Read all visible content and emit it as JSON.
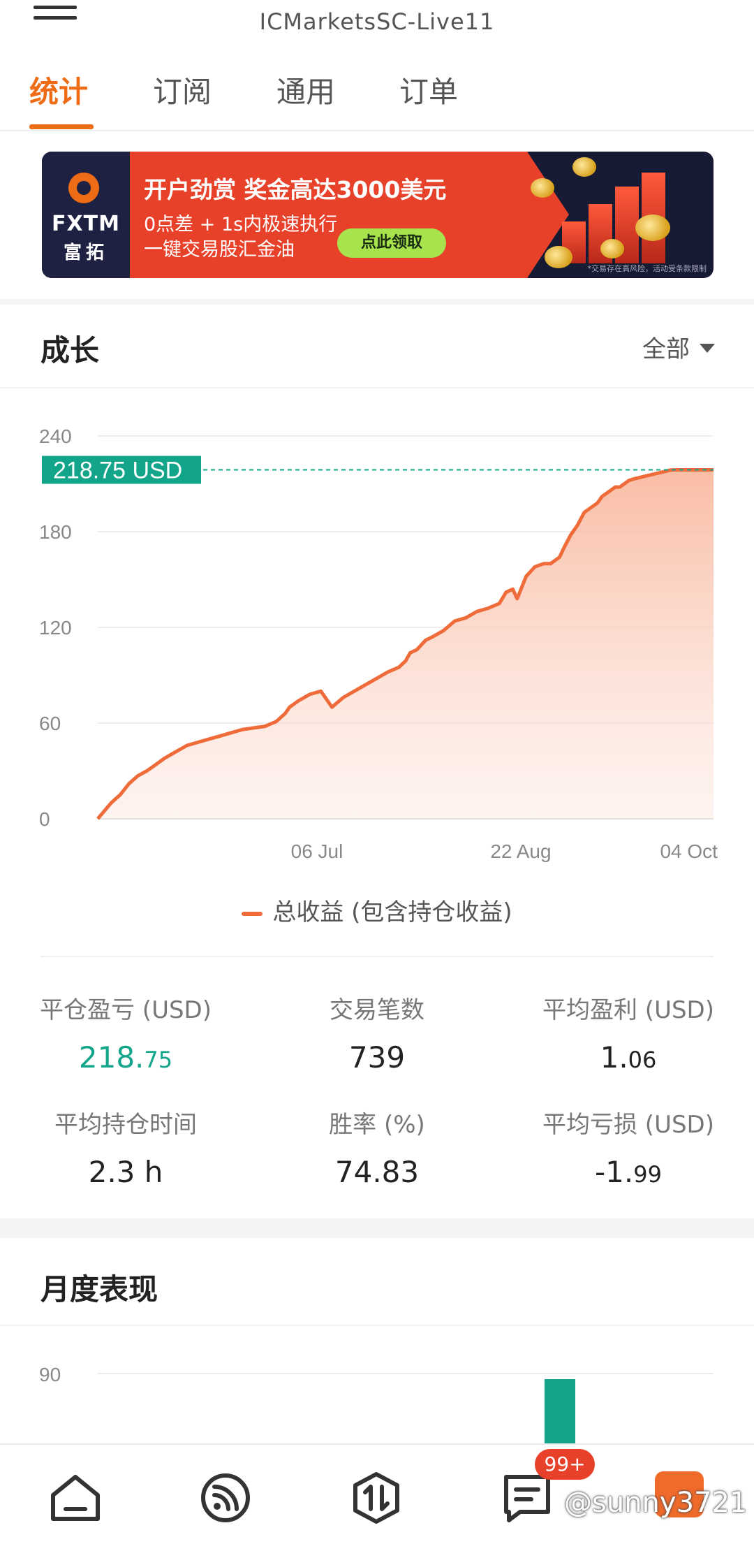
{
  "header": {
    "title": "ICMarketsSC-Live11"
  },
  "tabs": [
    {
      "label": "统计",
      "active": true
    },
    {
      "label": "订阅",
      "active": false
    },
    {
      "label": "通用",
      "active": false
    },
    {
      "label": "订单",
      "active": false
    }
  ],
  "banner": {
    "logo_text": "FXTM",
    "logo_cn": "富拓",
    "headline": "开户劲赏 奖金高达3000美元",
    "line1": "0点差 + 1s内极速执行",
    "line2": "一键交易股汇金油",
    "cta": "点此领取",
    "disclaimer": "*交易存在高风险，活动受条款限制"
  },
  "growth": {
    "title": "成长",
    "filter": "全部",
    "current_label": "218.75 USD",
    "legend": "总收益 (包含持仓收益)"
  },
  "chart_data": {
    "type": "area",
    "series": [
      {
        "name": "总收益 (包含持仓收益)",
        "x": [
          0,
          3,
          6,
          10,
          14,
          18,
          22,
          26,
          30,
          35,
          40,
          45,
          50,
          55,
          60,
          65,
          70,
          75,
          80,
          84,
          86,
          88,
          90,
          95,
          100,
          105,
          110,
          115,
          120,
          125,
          130,
          135,
          138,
          140,
          143,
          147,
          150,
          155,
          160,
          165,
          170,
          175,
          180,
          183,
          186,
          188,
          192,
          196,
          200,
          203,
          205,
          207,
          209,
          212,
          215,
          218,
          220,
          222,
          224,
          226,
          228,
          230,
          232,
          234,
          236,
          238,
          240,
          243,
          246,
          249,
          252,
          255,
          256,
          258,
          260,
          262,
          264,
          266,
          268,
          270,
          272,
          274,
          276
        ],
        "y": [
          0,
          5,
          10,
          15,
          22,
          27,
          30,
          34,
          38,
          42,
          46,
          48,
          50,
          52,
          54,
          56,
          57,
          58,
          61,
          66,
          70,
          72,
          74,
          78,
          80,
          70,
          76,
          80,
          84,
          88,
          92,
          95,
          99,
          104,
          106,
          112,
          114,
          118,
          124,
          126,
          130,
          132,
          135,
          142,
          144,
          138,
          152,
          158,
          160,
          160,
          162,
          164,
          170,
          178,
          184,
          192,
          194,
          196,
          198,
          202,
          204,
          206,
          208,
          208,
          210,
          212,
          213,
          214,
          215,
          216,
          217,
          218,
          218.5,
          218.7,
          218.75,
          218.75,
          218.75,
          218.75,
          218.75,
          218.75,
          218.75,
          218.75,
          218.75
        ]
      }
    ],
    "x_ticks": [
      "06 Jul",
      "22 Aug",
      "04 Oct"
    ],
    "y_ticks": [
      0,
      60,
      120,
      180,
      240
    ],
    "ylim": [
      0,
      240
    ],
    "grid": true,
    "colors": {
      "line": "#ef6c3a",
      "fill": "#fbd7c8",
      "marker_label_bg": "#12a58a"
    }
  },
  "stats": {
    "closed_pl_label": "平仓盈亏 (USD)",
    "closed_pl_int": "218.",
    "closed_pl_dec": "75",
    "trades_label": "交易笔数",
    "trades_value": "739",
    "avg_profit_label": "平均盈利 (USD)",
    "avg_profit_int": "1.",
    "avg_profit_dec": "06",
    "avg_hold_label": "平均持仓时间",
    "avg_hold_value": "2.3 h",
    "win_rate_label": "胜率 (%)",
    "win_rate_value": "74.83",
    "avg_loss_label": "平均亏损 (USD)",
    "avg_loss_int": "-1.",
    "avg_loss_dec": "99"
  },
  "monthly": {
    "title": "月度表现",
    "y_tick": "90"
  },
  "nav": {
    "badge": "99+",
    "watermark": "@sunny3721",
    "icons": [
      "home-icon",
      "feed-icon",
      "trade-icon",
      "messages-icon",
      "profile-icon"
    ]
  }
}
